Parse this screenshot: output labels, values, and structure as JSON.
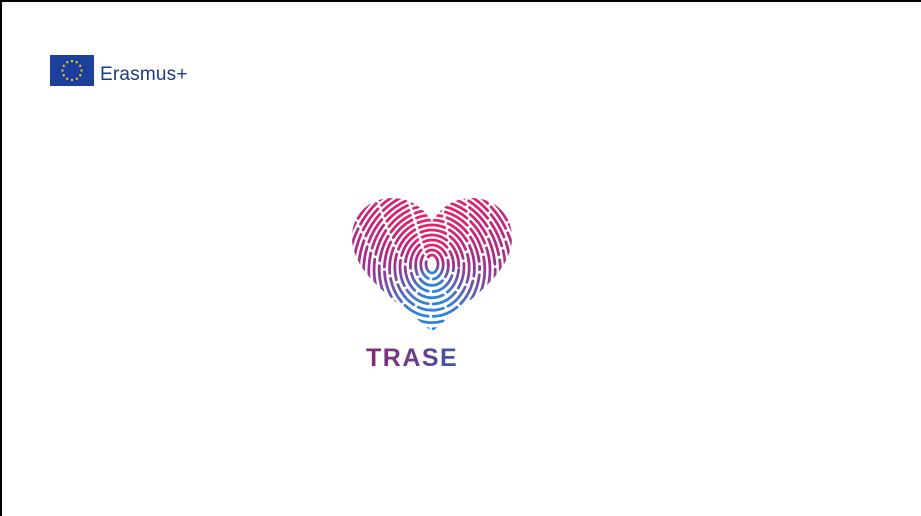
{
  "header": {
    "logo_text": "Erasmus+",
    "flag_icon": "eu-flag-icon"
  },
  "main": {
    "logo_icon": "fingerprint-heart-icon",
    "logo_text": "TRASE"
  },
  "colors": {
    "erasmus_blue": "#1a3a8a",
    "flag_blue": "#1b3f9a",
    "flag_star": "#ffdd00",
    "heart_magenta": "#d6246f",
    "heart_purple": "#7a3b9a",
    "heart_blue": "#2d7bd0",
    "trase_text": "#6a3d8f"
  }
}
